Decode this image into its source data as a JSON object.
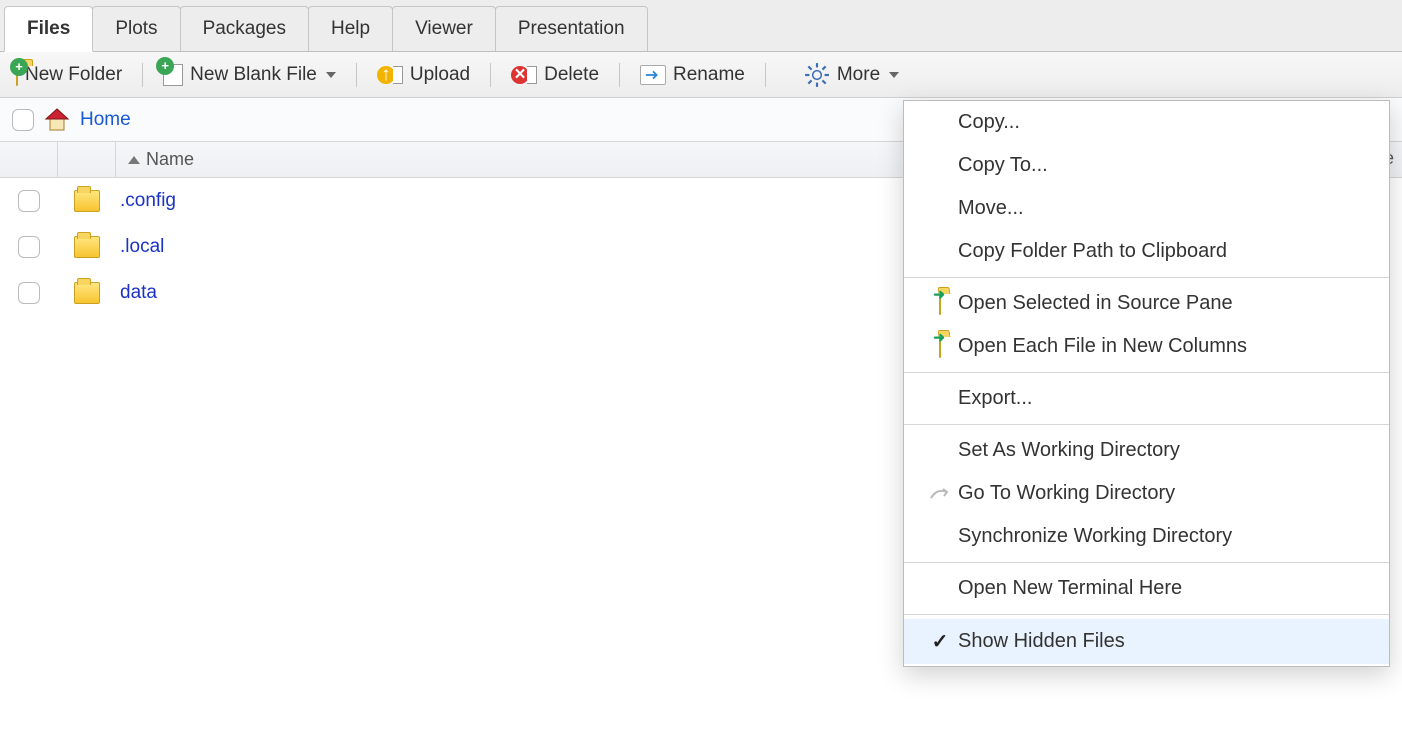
{
  "tabs": [
    {
      "label": "Files",
      "active": true
    },
    {
      "label": "Plots"
    },
    {
      "label": "Packages"
    },
    {
      "label": "Help"
    },
    {
      "label": "Viewer"
    },
    {
      "label": "Presentation"
    }
  ],
  "toolbar": {
    "new_folder": "New Folder",
    "new_blank_file": "New Blank File",
    "upload": "Upload",
    "delete": "Delete",
    "rename": "Rename",
    "more": "More"
  },
  "breadcrumb": {
    "home": "Home"
  },
  "columns": {
    "name": "Name",
    "size_partial": "e"
  },
  "files": [
    {
      "name": ".config",
      "type": "folder"
    },
    {
      "name": ".local",
      "type": "folder"
    },
    {
      "name": "data",
      "type": "folder"
    }
  ],
  "more_menu": [
    {
      "label": "Copy...",
      "icon": ""
    },
    {
      "label": "Copy To...",
      "icon": ""
    },
    {
      "label": "Move...",
      "icon": ""
    },
    {
      "label": "Copy Folder Path to Clipboard",
      "icon": ""
    },
    {
      "sep": true
    },
    {
      "label": "Open Selected in Source Pane",
      "icon": "folder-open"
    },
    {
      "label": "Open Each File in New Columns",
      "icon": "folder-open"
    },
    {
      "sep": true
    },
    {
      "label": "Export...",
      "icon": ""
    },
    {
      "sep": true
    },
    {
      "label": "Set As Working Directory",
      "icon": ""
    },
    {
      "label": "Go To Working Directory",
      "icon": "goto"
    },
    {
      "label": "Synchronize Working Directory",
      "icon": ""
    },
    {
      "sep": true
    },
    {
      "label": "Open New Terminal Here",
      "icon": ""
    },
    {
      "sep": true
    },
    {
      "label": "Show Hidden Files",
      "icon": "",
      "checked": true
    }
  ]
}
